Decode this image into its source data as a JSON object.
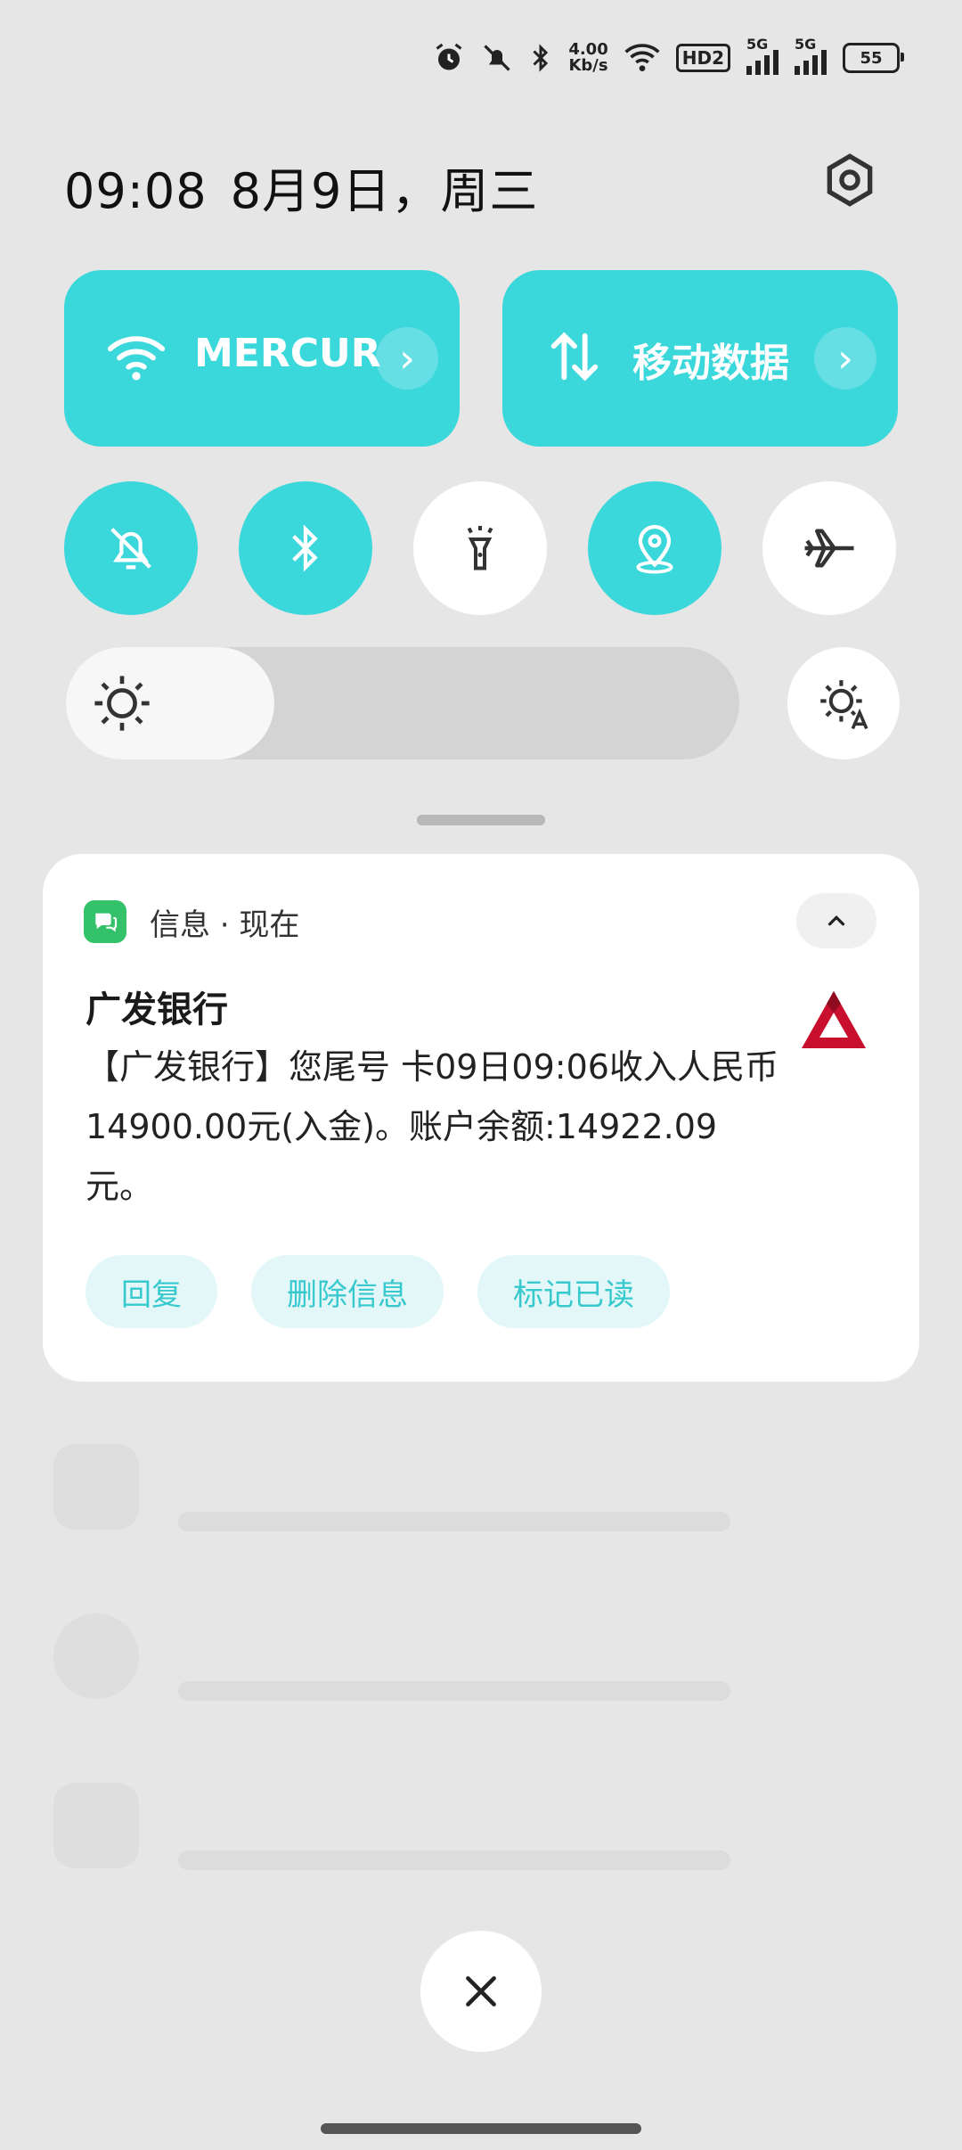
{
  "status_bar": {
    "net_speed_value": "4.00",
    "net_speed_unit": "Kb/s",
    "hd_label": "HD2",
    "signal1_label": "5G",
    "signal2_label": "5G",
    "battery_level": "55"
  },
  "header": {
    "time": "09:08",
    "date": "8月9日，周三"
  },
  "tiles": {
    "wifi_label": "MERCUR",
    "mobile_data_label": "移动数据"
  },
  "toggles": [
    {
      "name": "silent",
      "on": true
    },
    {
      "name": "bluetooth",
      "on": true
    },
    {
      "name": "flashlight",
      "on": false
    },
    {
      "name": "location",
      "on": true
    },
    {
      "name": "airplane",
      "on": false
    }
  ],
  "brightness": {
    "level": 0.31
  },
  "notification": {
    "app_line": "信息 · 现在",
    "sender": "广发银行",
    "message": "【广发银行】您尾号      卡09日09:06收入人民币14900.00元(入金)。账户余额:14922.09元。",
    "actions": [
      "回复",
      "删除信息",
      "标记已读"
    ]
  },
  "colors": {
    "accent": "#3ad7db",
    "chip_bg": "#e3f7f8",
    "chip_text": "#37c9cd",
    "bank_red": "#c8102e"
  }
}
